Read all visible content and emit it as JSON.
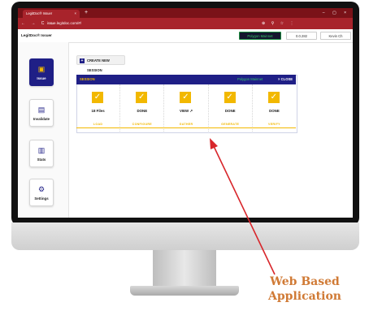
{
  "browser": {
    "tab_title": "LegitDoc® Issuer",
    "tab_close": "×",
    "new_tab": "+",
    "window_controls": "– ▢ ×",
    "nav_icons": "← → C ⌂",
    "address": "issue.legitdoc.com/#/",
    "toolbar_icons": "⊕ ⚲ ☆ ⋮"
  },
  "header": {
    "brand": "LegitDoc® Issuer",
    "network_button": "Polygon Mainnet",
    "wallet_button": "0.0.282",
    "user_button": "Kevin Ch"
  },
  "sidebar": {
    "items": [
      {
        "label": "Issue",
        "icon": "document-icon",
        "glyph": "▣",
        "active": true
      },
      {
        "label": "Invalidate",
        "icon": "file-icon",
        "glyph": "▤",
        "active": false
      },
      {
        "label": "Stats",
        "icon": "bar-chart-icon",
        "glyph": "▥",
        "active": false
      },
      {
        "label": "Settings",
        "icon": "gear-icon",
        "glyph": "⚙",
        "active": false
      }
    ]
  },
  "main": {
    "create_session": "CREATE NEW SESSION",
    "create_icon": "+",
    "session": {
      "title": "SESSION",
      "network": "Polygon Mainnet",
      "close": "× CLOSE",
      "steps": [
        {
          "value": "18 Files",
          "label": "LOAD"
        },
        {
          "value": "DONE",
          "label": "CONFIGURE"
        },
        {
          "value": "VIEW ↗",
          "label": "GATHER"
        },
        {
          "value": "DONE",
          "label": "GENERATE"
        },
        {
          "value": "DONE",
          "label": "VERIFY"
        }
      ],
      "check_glyph": "✓"
    }
  },
  "annotation": {
    "line1": "Web Based",
    "line2": "Application",
    "color": "#d07a35"
  },
  "colors": {
    "brand_red": "#a8232b",
    "navy": "#1f1f86",
    "accent_yellow": "#f2b800",
    "green": "#35c46a"
  }
}
